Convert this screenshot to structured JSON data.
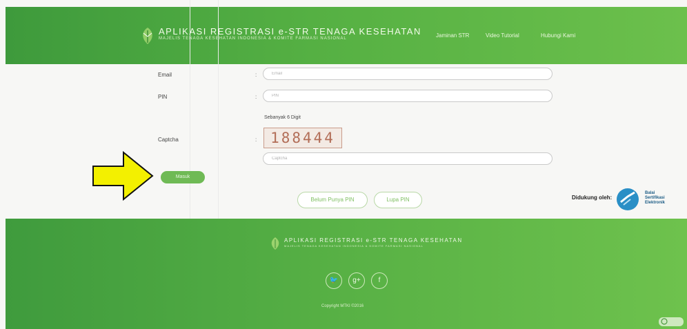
{
  "header": {
    "title": "APLIKASI REGISTRASI e-STR TENAGA KESEHATAN",
    "subtitle": "MAJELIS TENAGA KESEHATAN INDONESIA & KOMITE FARMASI NASIONAL",
    "nav": [
      "Jaminan STR",
      "Video Tutorial",
      "Hubungi Kami"
    ]
  },
  "form": {
    "email": {
      "label": "Email",
      "placeholder": "Email"
    },
    "pin": {
      "label": "PIN",
      "placeholder": "PIN",
      "hint": "Sebanyak 6 Digit"
    },
    "captcha": {
      "label": "Captcha",
      "code": "188444",
      "placeholder": "Captcha"
    },
    "colon": ":",
    "submit": "Masuk"
  },
  "links": {
    "no_pin": "Belum Punya PIN",
    "forgot_pin": "Lupa PIN"
  },
  "support": {
    "label": "Didukung oleh:",
    "org_line1": "Balai",
    "org_line2": "Sertifikasi",
    "org_line3": "Elektronik"
  },
  "footer": {
    "title": "APLIKASI REGISTRASI e-STR TENAGA KESEHATAN",
    "subtitle": "MAJELIS TENAGA KESEHATAN INDONESIA & KOMITE FARMASI NASIONAL",
    "social": [
      "twitter-icon",
      "google-plus-icon",
      "facebook-icon"
    ],
    "copyright": "Copyright MTKI ©2016"
  },
  "colors": {
    "brand_green": "#55b043",
    "annotation_arrow": "#f3f000"
  }
}
